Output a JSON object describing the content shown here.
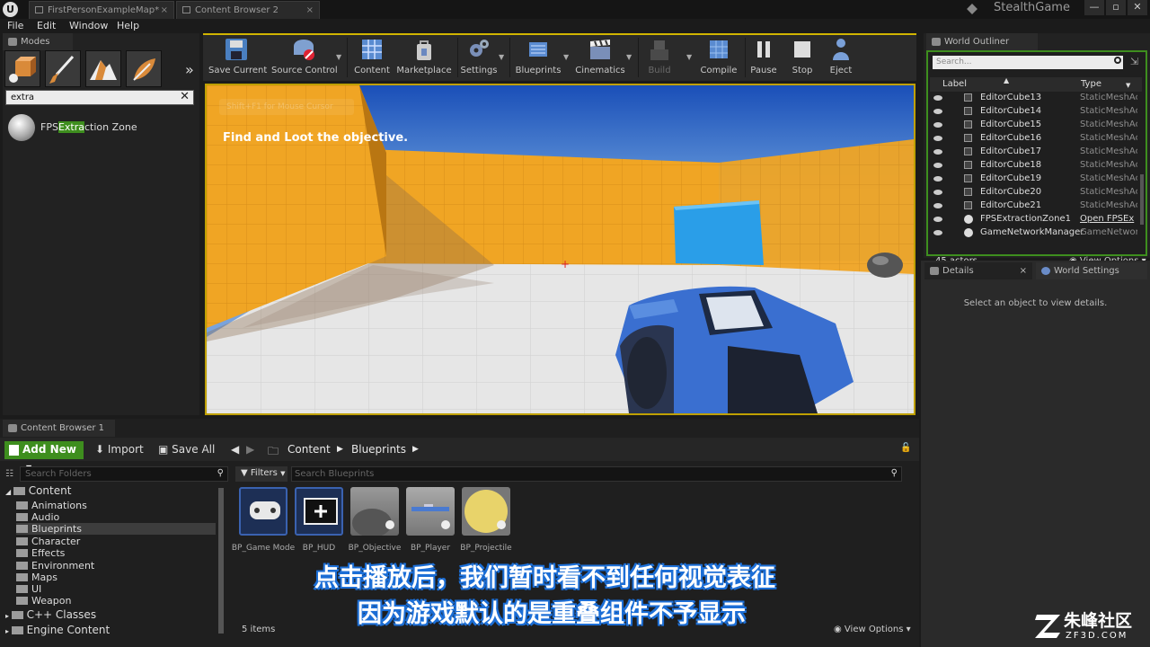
{
  "window": {
    "tabs": [
      "FirstPersonExampleMap*",
      "Content Browser 2"
    ],
    "project_name": "StealthGame"
  },
  "menu": [
    "File",
    "Edit",
    "Window",
    "Help"
  ],
  "modes": {
    "tab_label": "Modes",
    "search_value": "extra",
    "result": {
      "prefix": "FPS",
      "match": "Extra",
      "suffix": "ction Zone"
    }
  },
  "toolbar": {
    "buttons": [
      "Save Current",
      "Source Control",
      "Content",
      "Marketplace",
      "Settings",
      "Blueprints",
      "Cinematics",
      "Build",
      "Compile",
      "Pause",
      "Stop",
      "Eject"
    ]
  },
  "viewport": {
    "hint": "Shift+F1 for Mouse Cursor",
    "objective": "Find and Loot the objective."
  },
  "outliner": {
    "tab_label": "World Outliner",
    "search_placeholder": "Search...",
    "col_label": "Label",
    "col_type": "Type",
    "rows": [
      {
        "label": "EditorCube13",
        "type": "StaticMeshAc"
      },
      {
        "label": "EditorCube14",
        "type": "StaticMeshAc"
      },
      {
        "label": "EditorCube15",
        "type": "StaticMeshAc"
      },
      {
        "label": "EditorCube16",
        "type": "StaticMeshAc"
      },
      {
        "label": "EditorCube17",
        "type": "StaticMeshAc"
      },
      {
        "label": "EditorCube18",
        "type": "StaticMeshAc"
      },
      {
        "label": "EditorCube19",
        "type": "StaticMeshAc"
      },
      {
        "label": "EditorCube20",
        "type": "StaticMeshAc"
      },
      {
        "label": "EditorCube21",
        "type": "StaticMeshAc"
      },
      {
        "label": "FPSExtractionZone1",
        "type": "Open FPSEx"
      },
      {
        "label": "GameNetworkManager",
        "type": "GameNetwork"
      }
    ],
    "count": "45 actors",
    "view_options": "View Options"
  },
  "details": {
    "tab_details": "Details",
    "tab_world_settings": "World Settings",
    "empty_message": "Select an object to view details."
  },
  "content_browser": {
    "tab_label": "Content Browser 1",
    "add_new": "Add New",
    "import": "Import",
    "save_all": "Save All",
    "breadcrumb": [
      "Content",
      "Blueprints"
    ],
    "folder_search_placeholder": "Search Folders",
    "filters": "Filters",
    "asset_search_placeholder": "Search Blueprints",
    "tree": [
      {
        "label": "Content",
        "level": 0
      },
      {
        "label": "Animations",
        "level": 1
      },
      {
        "label": "Audio",
        "level": 1
      },
      {
        "label": "Blueprints",
        "level": 1,
        "selected": true
      },
      {
        "label": "Character",
        "level": 1
      },
      {
        "label": "Effects",
        "level": 1
      },
      {
        "label": "Environment",
        "level": 1
      },
      {
        "label": "Maps",
        "level": 1
      },
      {
        "label": "UI",
        "level": 1
      },
      {
        "label": "Weapon",
        "level": 1
      },
      {
        "label": "C++ Classes",
        "level": 0
      },
      {
        "label": "Engine Content",
        "level": 0
      }
    ],
    "assets": [
      {
        "name": "BP_Game Mode"
      },
      {
        "name": "BP_HUD"
      },
      {
        "name": "BP_Objective"
      },
      {
        "name": "BP_Player"
      },
      {
        "name": "BP_Projectile"
      }
    ],
    "item_count": "5 items",
    "view_options": "View Options"
  },
  "subtitles": [
    "点击播放后，我们暂时看不到任何视觉表征",
    "因为游戏默认的是重叠组件不予显示"
  ],
  "watermark": {
    "brand": "朱峰社区",
    "url": "ZF3D.COM"
  }
}
